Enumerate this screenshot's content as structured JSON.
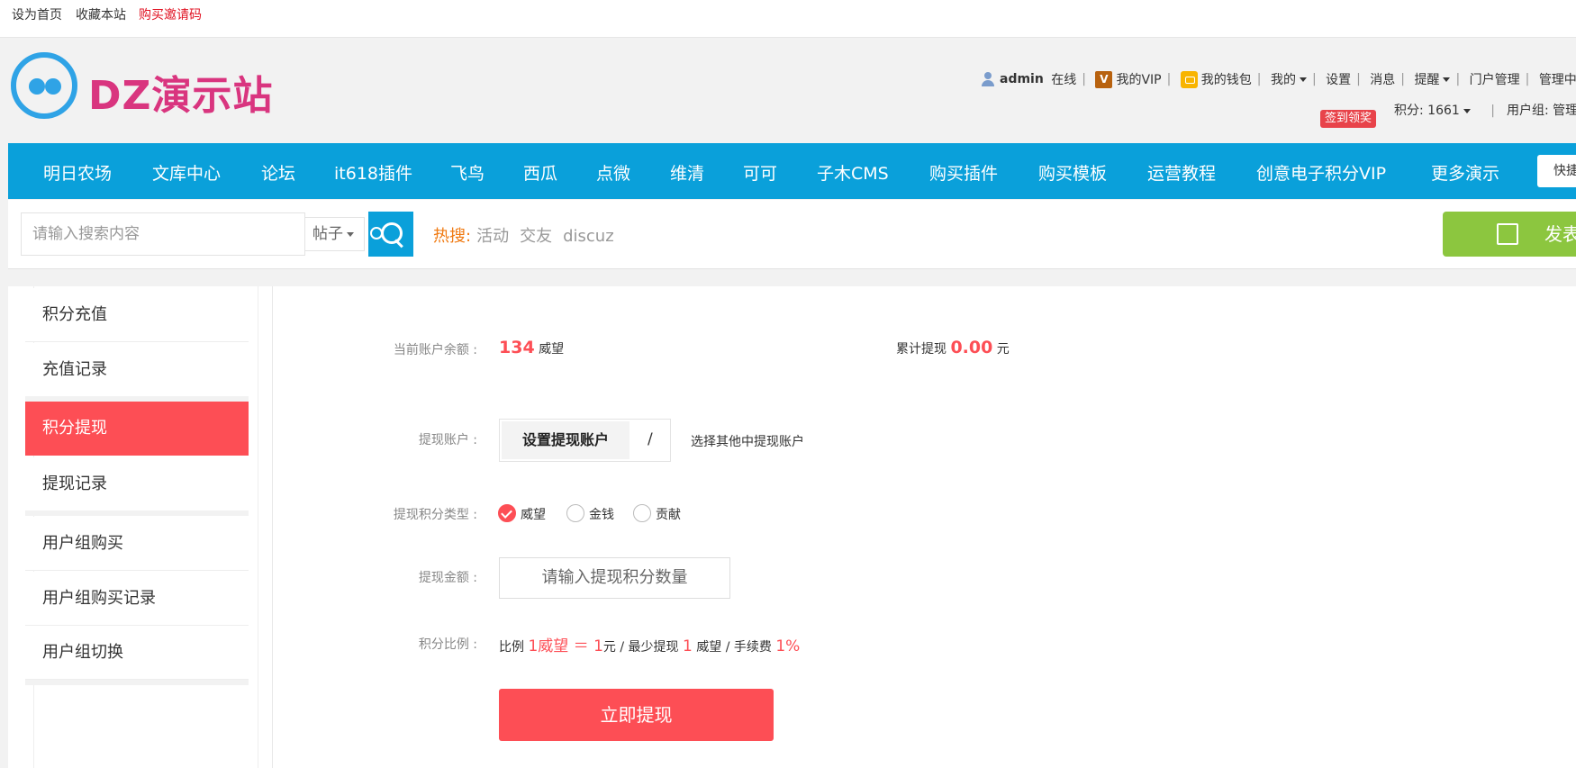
{
  "topbar": {
    "set_home": "设为首页",
    "bookmark": "收藏本站",
    "buy_invite": "购买邀请码"
  },
  "header": {
    "logo_text": "DZ演示站",
    "username": "admin",
    "online": "在线",
    "vip_badge": "V",
    "my_vip": "我的VIP",
    "my_wallet": "我的钱包",
    "mine": "我的",
    "settings": "设置",
    "messages": "消息",
    "reminders": "提醒",
    "portal_admin": "门户管理",
    "admin_center": "管理中心",
    "sign_badge": "签到领奖",
    "points": "积分: 1661",
    "usergroup": "用户组: 管理员"
  },
  "nav": {
    "items": [
      "明日农场",
      "文库中心",
      "论坛",
      "it618插件",
      "飞鸟",
      "西瓜",
      "点微",
      "维清",
      "可可",
      "子木CMS",
      "购买插件",
      "购买模板",
      "运营教程",
      "创意电子积分VIP",
      "更多演示"
    ],
    "quick": "快捷"
  },
  "search": {
    "placeholder": "请输入搜索内容",
    "type": "帖子",
    "hot_label": "热搜:",
    "hot_keywords": [
      "活动",
      "交友",
      "discuz"
    ],
    "post_button": "发表"
  },
  "sidebar": {
    "items": [
      "积分充值",
      "充值记录",
      "积分提现",
      "提现记录",
      "用户组购买",
      "用户组购买记录",
      "用户组切换"
    ]
  },
  "withdraw": {
    "balance_label": "当前账户余额 :",
    "balance_value": "134",
    "balance_unit": "威望",
    "total_label": "累计提现",
    "total_value": "0.00",
    "total_unit": "元",
    "account_label": "提现账户 :",
    "set_account": "设置提现账户",
    "slash": "/",
    "other_account": "选择其他中提现账户",
    "type_label": "提现积分类型 :",
    "types": [
      "威望",
      "金钱",
      "贡献"
    ],
    "amount_label": "提现金额 :",
    "amount_placeholder": "请输入提现积分数量",
    "ratio_label": "积分比例 :",
    "ratio_prefix": "比例",
    "ratio_value": "1威望 ＝ 1",
    "ratio_unit": "元 / 最少提现",
    "min_value": "1",
    "min_unit": "威望 / 手续费",
    "fee_value": "1%",
    "submit": "立即提现"
  },
  "colors": {
    "primary_blue": "#0aa0da",
    "accent_red": "#fd4e55",
    "post_green": "#8cc63f",
    "logo_pink": "#d9357f"
  }
}
